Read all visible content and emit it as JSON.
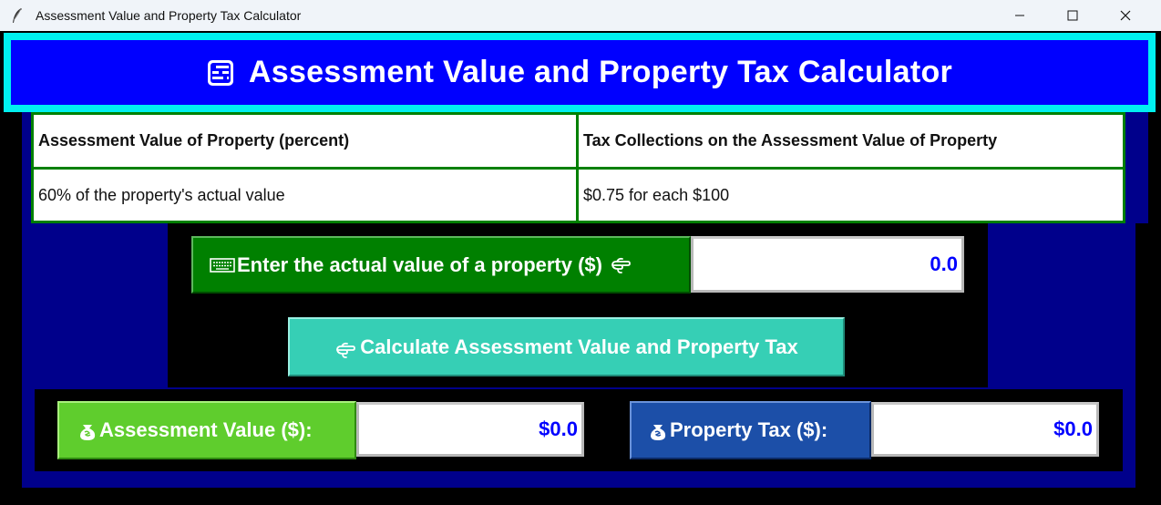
{
  "window": {
    "title": "Assessment Value and Property Tax Calculator",
    "controls": {
      "minimize": "—",
      "maximize": "☐",
      "close": "✕"
    }
  },
  "header": {
    "title": "Assessment Value and Property Tax Calculator",
    "icon": "abacus-icon"
  },
  "table": {
    "headers": [
      "Assessment Value of Property (percent)",
      "Tax Collections on the Assessment Value of Property"
    ],
    "rows": [
      [
        "60% of the property's actual value",
        "$0.75 for each $100"
      ]
    ]
  },
  "input": {
    "label": "Enter the actual value of a property ($)",
    "value": "0.0",
    "icon_left": "keyboard-icon",
    "icon_right": "pointing-hand-icon"
  },
  "calculate_button": {
    "label": "Calculate Assessment Value and Property Tax",
    "icon": "pointing-hand-icon"
  },
  "results": {
    "assessment_label": "Assessment Value ($):",
    "assessment_value": "$0.0",
    "tax_label": "Property Tax ($):",
    "tax_value": "$0.0",
    "icon": "money-bag-icon"
  },
  "colors": {
    "header_bg": "#0000ff",
    "header_border": "#00f0f0",
    "navy": "#00008b",
    "table_border": "#008000",
    "input_button": "#008000",
    "calculate_button": "#36cfb5",
    "assessment_button": "#5fcd2d",
    "tax_button": "#1c4fa8",
    "value_text": "#0000ff"
  }
}
